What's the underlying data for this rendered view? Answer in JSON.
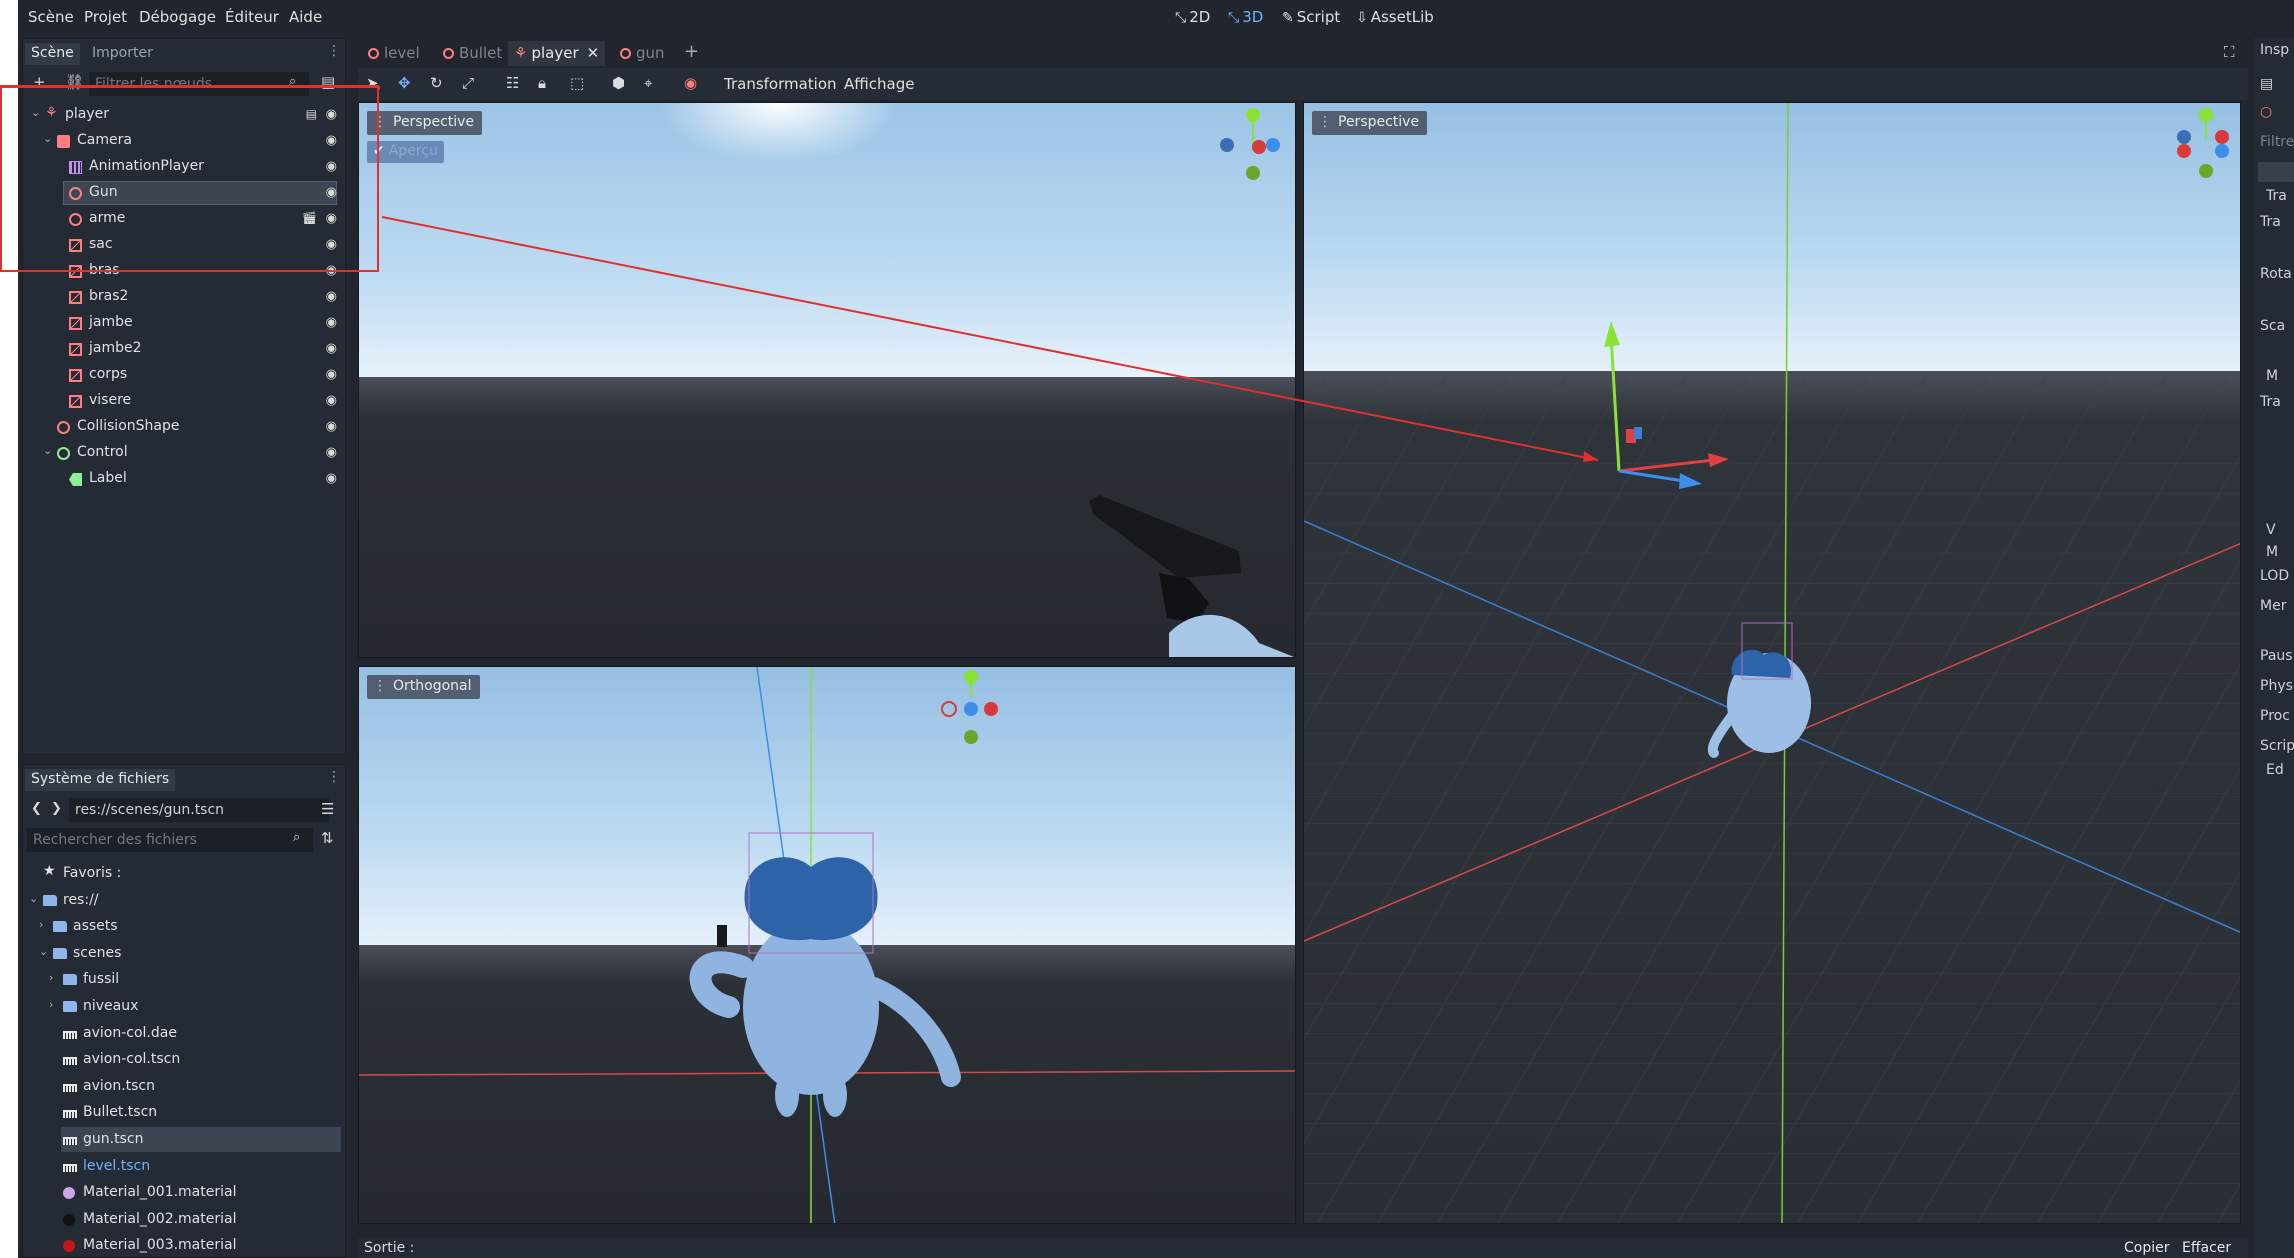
{
  "menu": {
    "items": [
      "Scène",
      "Projet",
      "Débogage",
      "Éditeur",
      "Aide"
    ],
    "modes": [
      {
        "glyph": "⤡",
        "label": "2D"
      },
      {
        "glyph": "⤡",
        "label": "3D"
      },
      {
        "glyph": "✎",
        "label": "Script"
      },
      {
        "glyph": "⇩",
        "label": "AssetLib"
      }
    ],
    "active_mode": "3D"
  },
  "scene_dock": {
    "tabs": [
      "Scène",
      "Importer"
    ],
    "filter_placeholder": "Filtrer les nœuds",
    "tree": [
      {
        "label": "player",
        "icon": "player-icon",
        "depth": 0,
        "expanded": true,
        "script": true
      },
      {
        "label": "Camera",
        "icon": "camera-icon",
        "depth": 1,
        "expanded": true
      },
      {
        "label": "AnimationPlayer",
        "icon": "animation-player-icon",
        "depth": 2
      },
      {
        "label": "Gun",
        "icon": "spatial-icon",
        "depth": 2,
        "selected": true
      },
      {
        "label": "arme",
        "icon": "spatial-icon",
        "depth": 2,
        "scene": true
      },
      {
        "label": "sac",
        "icon": "mesh-icon",
        "depth": 2
      },
      {
        "label": "bras",
        "icon": "mesh-icon",
        "depth": 2
      },
      {
        "label": "bras2",
        "icon": "mesh-icon",
        "depth": 2
      },
      {
        "label": "jambe",
        "icon": "mesh-icon",
        "depth": 2
      },
      {
        "label": "jambe2",
        "icon": "mesh-icon",
        "depth": 2
      },
      {
        "label": "corps",
        "icon": "mesh-icon",
        "depth": 2
      },
      {
        "label": "visere",
        "icon": "mesh-icon",
        "depth": 2
      },
      {
        "label": "CollisionShape",
        "icon": "collision-shape-icon",
        "depth": 1
      },
      {
        "label": "Control",
        "icon": "control-icon",
        "depth": 1,
        "expanded": true
      },
      {
        "label": "Label",
        "icon": "label-icon",
        "depth": 2
      }
    ]
  },
  "fs_dock": {
    "title": "Système de fichiers",
    "path": "res://scenes/gun.tscn",
    "search_placeholder": "Rechercher des fichiers",
    "items": [
      {
        "label": "Favoris :",
        "icon": "star-icon",
        "depth": 0
      },
      {
        "label": "res://",
        "icon": "folder-icon",
        "depth": 0,
        "expanded": true
      },
      {
        "label": "assets",
        "icon": "folder-icon",
        "depth": 1,
        "collapsed": true
      },
      {
        "label": "scenes",
        "icon": "folder-icon",
        "depth": 1,
        "expanded": true
      },
      {
        "label": "fussil",
        "icon": "folder-icon",
        "depth": 2,
        "collapsed": true
      },
      {
        "label": "niveaux",
        "icon": "folder-icon",
        "depth": 2,
        "collapsed": true
      },
      {
        "label": "avion-col.dae",
        "icon": "scene-file-icon",
        "depth": 2
      },
      {
        "label": "avion-col.tscn",
        "icon": "scene-file-icon",
        "depth": 2
      },
      {
        "label": "avion.tscn",
        "icon": "scene-file-icon",
        "depth": 2
      },
      {
        "label": "Bullet.tscn",
        "icon": "scene-file-icon",
        "depth": 2
      },
      {
        "label": "gun.tscn",
        "icon": "scene-file-icon",
        "depth": 2,
        "selected": true
      },
      {
        "label": "level.tscn",
        "icon": "scene-file-icon",
        "depth": 2,
        "highlight": true
      },
      {
        "label": "Material_001.material",
        "icon": "material-icon",
        "depth": 2,
        "color": "#c9a6e8"
      },
      {
        "label": "Material_002.material",
        "icon": "material-icon",
        "depth": 2,
        "color": "#111111"
      },
      {
        "label": "Material_003.material",
        "icon": "material-icon",
        "depth": 2,
        "color": "#c01818"
      }
    ]
  },
  "editor": {
    "tabs": [
      {
        "label": "level",
        "active": false
      },
      {
        "label": "Bullet",
        "active": false
      },
      {
        "label": "player",
        "active": true
      },
      {
        "label": "gun",
        "active": false
      }
    ],
    "toolbar": {
      "transform_label": "Transformation",
      "view_label": "Affichage"
    },
    "viewports": {
      "top_left": {
        "label": "Perspective",
        "preview": "Aperçu"
      },
      "bottom_left": {
        "label": "Orthogonal"
      },
      "right": {
        "label": "Perspective"
      }
    },
    "output": {
      "label": "Sortie :",
      "copy": "Copier",
      "clear": "Effacer"
    }
  },
  "inspector": {
    "title": "Insp",
    "rows": [
      "Filtre",
      "Tra",
      "Rota",
      "Sca",
      "M",
      "Tra",
      "V",
      "M",
      "LOD",
      "Mer",
      "Paus",
      "Phys",
      "Proc",
      "Scrip",
      "Ed"
    ]
  },
  "colors": {
    "accent": "#6fb2ff",
    "node_red": "#fc7f7f",
    "annotation_red": "#e03030"
  }
}
